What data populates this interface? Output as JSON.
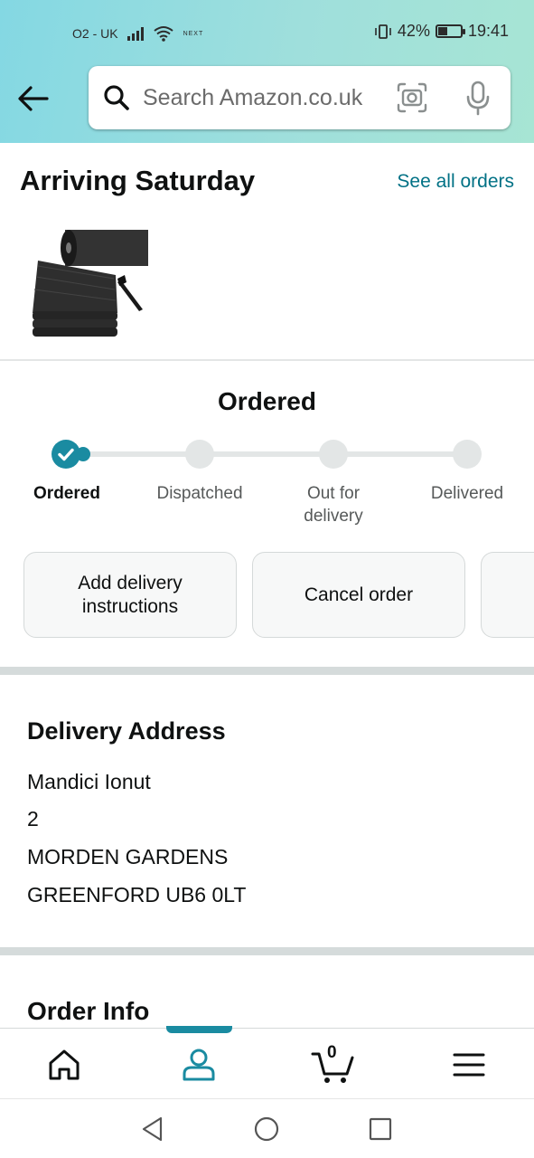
{
  "status_bar": {
    "carrier": "O2 - UK",
    "network_tag": "NEXT",
    "battery_percent": "42%",
    "battery_level": 0.42,
    "time": "19:41"
  },
  "search": {
    "placeholder": "Search Amazon.co.uk"
  },
  "arriving": {
    "title": "Arriving Saturday",
    "see_all_label": "See all orders"
  },
  "tracking": {
    "current_status": "Ordered",
    "steps": [
      {
        "label": "Ordered",
        "done": true
      },
      {
        "label": "Dispatched",
        "done": false
      },
      {
        "label": "Out for delivery",
        "done": false
      },
      {
        "label": "Delivered",
        "done": false
      }
    ]
  },
  "actions": [
    {
      "label": "Add delivery instructions"
    },
    {
      "label": "Cancel order"
    },
    {
      "label": ""
    }
  ],
  "delivery_address": {
    "title": "Delivery Address",
    "lines": [
      "Mandici Ionut",
      "2",
      "MORDEN GARDENS",
      "GREENFORD UB6 0LT"
    ]
  },
  "order_info": {
    "title": "Order Info"
  },
  "bottom_nav": {
    "cart_count": "0",
    "active_tab": "account"
  },
  "icons": {
    "back": "back-arrow-icon",
    "search": "search-icon",
    "camera": "camera-scan-icon",
    "mic": "microphone-icon",
    "home": "home-icon",
    "account": "person-icon",
    "cart": "cart-icon",
    "menu": "menu-icon"
  },
  "colors": {
    "accent": "#007185",
    "teal": "#1a8ba1",
    "header_start": "#84d8e3",
    "header_end": "#a7e5d4"
  }
}
